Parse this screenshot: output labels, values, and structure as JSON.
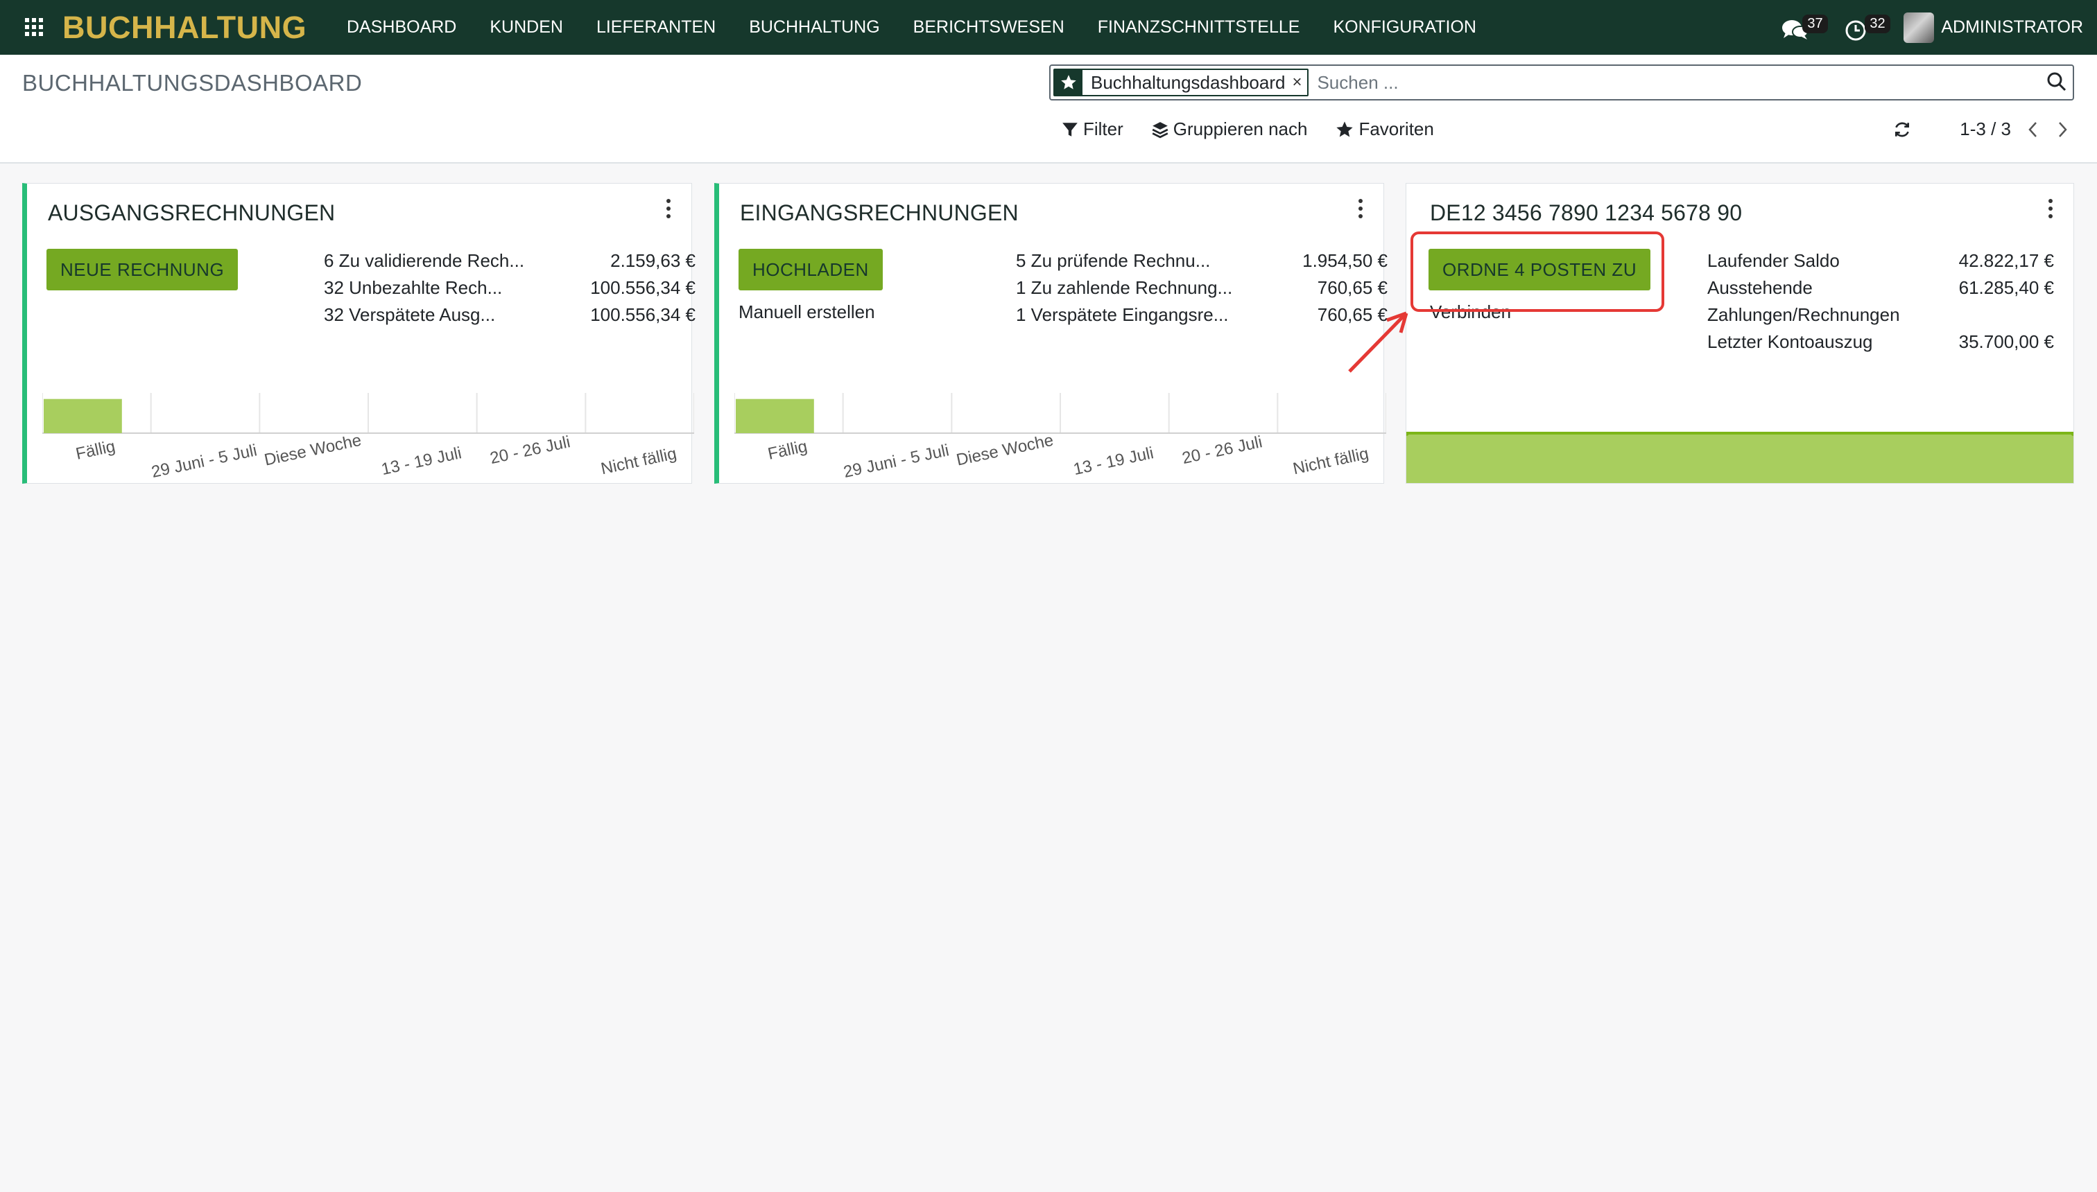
{
  "app": {
    "brand": "BUCHHALTUNG",
    "menu": [
      "DASHBOARD",
      "KUNDEN",
      "LIEFERANTEN",
      "BUCHHALTUNG",
      "BERICHTSWESEN",
      "FINANZSCHNITTSTELLE",
      "KONFIGURATION"
    ],
    "messages_count": "37",
    "activities_count": "32",
    "user": "ADMINISTRATOR"
  },
  "control_panel": {
    "title": "BUCHHALTUNGSDASHBOARD",
    "facet": "Buchhaltungsdashboard",
    "facet_remove": "×",
    "search_placeholder": "Suchen ...",
    "filter_label": "Filter",
    "groupby_label": "Gruppieren nach",
    "favorites_label": "Favoriten",
    "pager": "1-3 / 3"
  },
  "cards": [
    {
      "title": "AUSGANGSRECHNUNGEN",
      "button": "NEUE RECHNUNG",
      "stats": [
        {
          "label": "6 Zu validierende Rech...",
          "value": "2.159,63 €"
        },
        {
          "label": "32 Unbezahlte Rech...",
          "value": "100.556,34 €"
        },
        {
          "label": "32 Verspätete Ausg...",
          "value": "100.556,34 €"
        }
      ]
    },
    {
      "title": "EINGANGSRECHNUNGEN",
      "button": "HOCHLADEN",
      "link": "Manuell erstellen",
      "stats": [
        {
          "label": "5 Zu prüfende Rechnu...",
          "value": "1.954,50 €"
        },
        {
          "label": "1 Zu zahlende Rechnung...",
          "value": "760,65 €"
        },
        {
          "label": "1 Verspätete Eingangsre...",
          "value": "760,65 €"
        }
      ]
    },
    {
      "title": "DE12 3456 7890 1234 5678 90",
      "button": "ORDNE 4 POSTEN ZU",
      "link": "Verbinden",
      "stats": [
        {
          "label": "Laufender Saldo",
          "value": "42.822,17 €"
        },
        {
          "label": "Ausstehende",
          "value": "61.285,40 €"
        },
        {
          "label": "Zahlungen/Rechnungen",
          "value": ""
        },
        {
          "label": "Letzter Kontoauszug",
          "value": "35.700,00 €"
        }
      ]
    }
  ],
  "chart_data": [
    {
      "type": "bar",
      "categories": [
        "Fällig",
        "29 Juni - 5 Juli",
        "Diese Woche",
        "13 - 19 Juli",
        "20 - 26 Juli",
        "Nicht fällig"
      ],
      "values": [
        1,
        0,
        0,
        0,
        0,
        0
      ],
      "color": "#a8ce5e"
    },
    {
      "type": "bar",
      "categories": [
        "Fällig",
        "29 Juni - 5 Juli",
        "Diese Woche",
        "13 - 19 Juli",
        "20 - 26 Juli",
        "Nicht fällig"
      ],
      "values": [
        1,
        0,
        0,
        0,
        0,
        0
      ],
      "color": "#a8ce5e"
    },
    {
      "type": "area",
      "values": [
        1,
        1
      ],
      "color": "#a8ce5e"
    }
  ]
}
